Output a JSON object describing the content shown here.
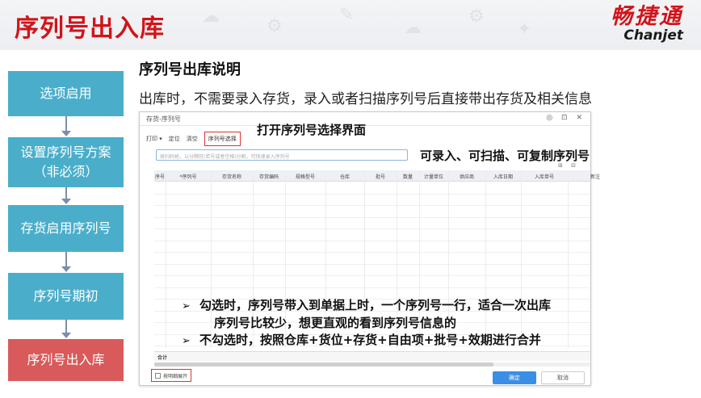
{
  "slide": {
    "title": "序列号出入库",
    "brand_cn": "畅捷通",
    "brand_en": "Chanjet"
  },
  "flow": {
    "steps": [
      {
        "label": "选项启用",
        "active": false
      },
      {
        "label": "设置序列号方案（非必须）",
        "active": false
      },
      {
        "label": "存货启用序列号",
        "active": false
      },
      {
        "label": "序列号期初",
        "active": false
      },
      {
        "label": "序列号出入库",
        "active": true
      }
    ],
    "colors": {
      "normal": "#4aaeca",
      "active": "#d95a5a",
      "connector": "#7a8ea8"
    }
  },
  "content": {
    "subtitle": "序列号出库说明",
    "description": "出库时，不需要录入存货，录入或者扫描序列号后直接带出存货及相关信息"
  },
  "dialog": {
    "title": "存货-序列号",
    "window_controls": "◎ ⊡ ✕",
    "toolbar": {
      "print": "打印 ▾",
      "locate": "定位",
      "clear": "清空",
      "serial_select": "序列号选择"
    },
    "input_placeholder": "按扫码枪，以分隔符(若号或者空格)分割，可快速录入序列号",
    "mini_icons": "⊞ ⊟",
    "columns": [
      "序号",
      "*序列号",
      "存货名称",
      "存货编码",
      "规格型号",
      "仓库",
      "批号",
      "数量",
      "计量单位",
      "供应商",
      "入库日期",
      "入库单号",
      "新注"
    ],
    "total_label": "合计",
    "checkbox_label": "按明细展开",
    "ok_button": "确定",
    "cancel_button": "取消"
  },
  "annotations": {
    "open_select": "打开序列号选择界面",
    "input_hint": "可录入、可扫描、可复制序列号",
    "notes": [
      {
        "bullet": "➢",
        "text": "勾选时，序列号带入到单据上时，一个序列号一行，适合一次出库"
      },
      {
        "bullet": "",
        "text": "序列号比较少，想更直观的看到序列号信息的"
      },
      {
        "bullet": "➢",
        "text": "不勾选时，按照仓库+货位+存货+自由项+批号+效期进行合并"
      }
    ]
  },
  "colors": {
    "title_red": "#d0141a",
    "ok_blue": "#3a8ee6",
    "highlight_red": "#dd3333"
  }
}
